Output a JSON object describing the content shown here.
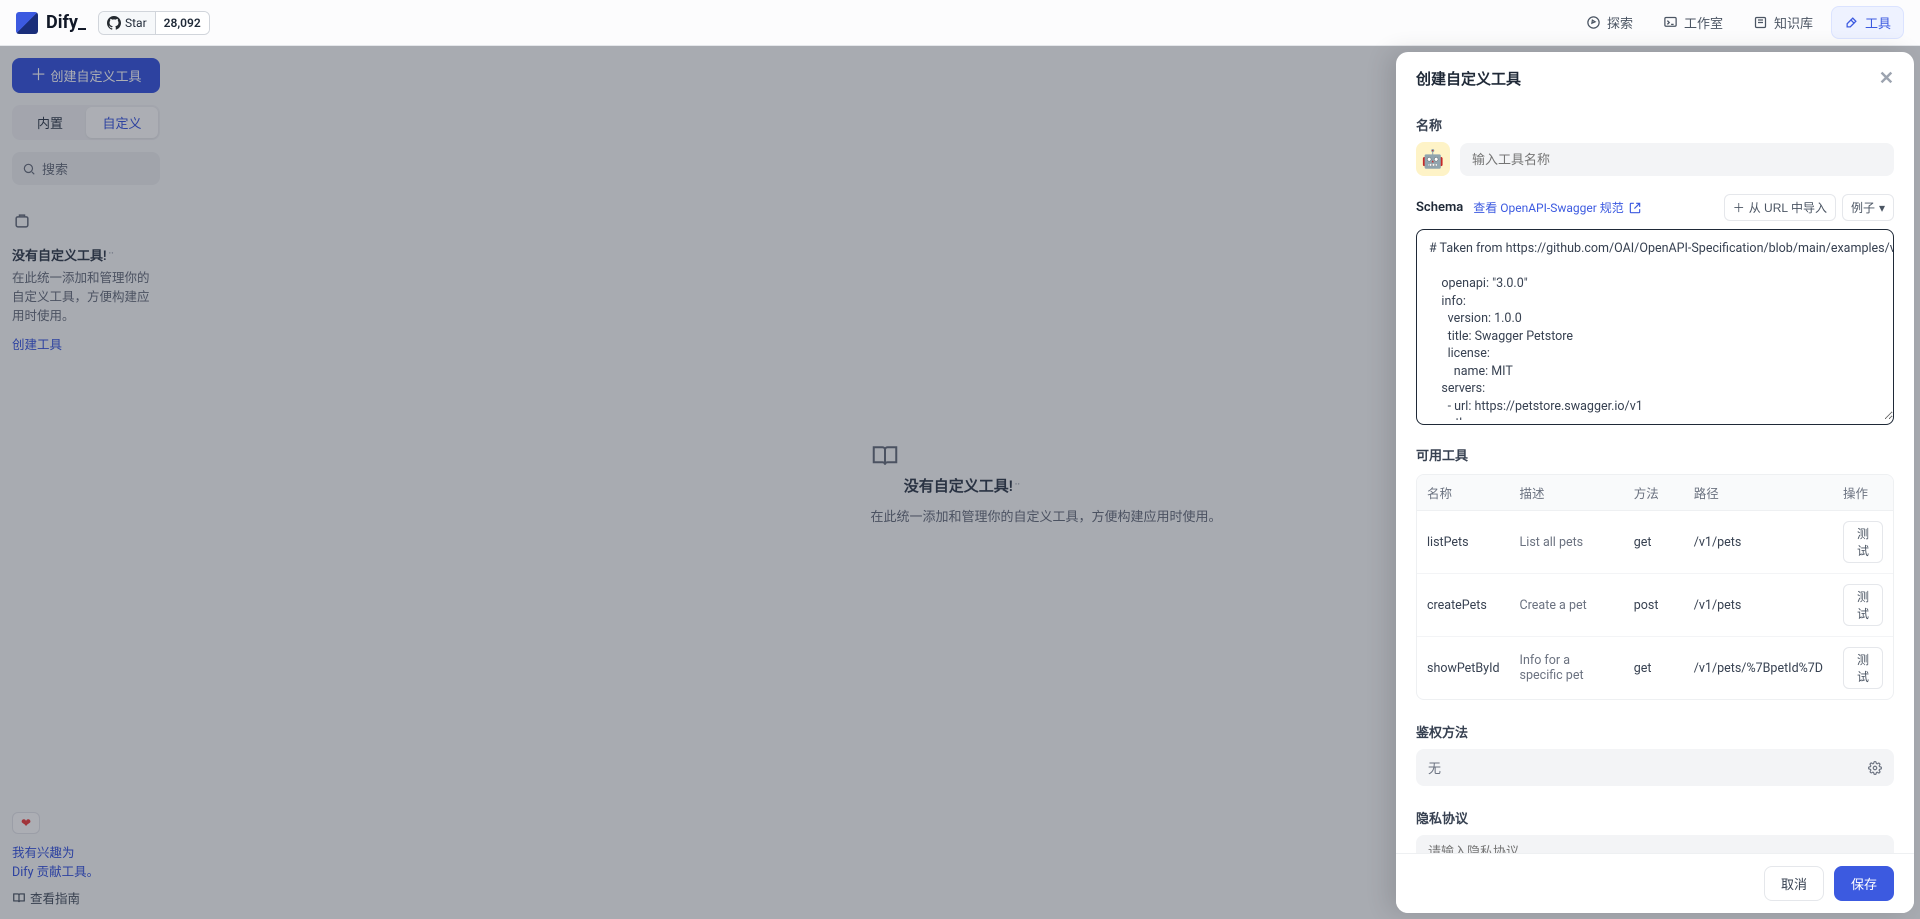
{
  "header": {
    "logo_text": "Dify_",
    "github": {
      "star_label": "Star",
      "stars": "28,092"
    },
    "nav": {
      "explore": "探索",
      "studio": "工作室",
      "knowledge": "知识库",
      "tools": "工具"
    }
  },
  "sidebar": {
    "create_button": "创建自定义工具",
    "tabs": {
      "builtin": "内置",
      "custom": "自定义"
    },
    "search_placeholder": "搜索",
    "empty": {
      "title": "没有自定义工具!",
      "desc": "在此统一添加和管理你的自定义工具，方便构建应用时使用。",
      "create_link": "创建工具"
    },
    "footer": {
      "line1": "我有兴趣为",
      "line2": "Dify 贡献工具。",
      "guide": "查看指南"
    }
  },
  "center": {
    "title": "没有自定义工具!",
    "desc": "在此统一添加和管理你的自定义工具，方便构建应用时使用。"
  },
  "drawer": {
    "title": "创建自定义工具",
    "name_label": "名称",
    "name_placeholder": "输入工具名称",
    "tool_emoji": "🤖",
    "schema_label": "Schema",
    "spec_link": "查看 OpenAPI-Swagger 规范",
    "import_url": "从 URL 中导入",
    "examples": "例子",
    "schema_text": "# Taken from https://github.com/OAI/OpenAPI-Specification/blob/main/examples/v3.0/petstore.yaml\n\n    openapi: \"3.0.0\"\n    info:\n      version: 1.0.0\n      title: Swagger Petstore\n      license:\n        name: MIT\n    servers:\n      - url: https://petstore.swagger.io/v1\n    paths:\n      /pets:\n        get:\n          summary: List all pets",
    "available_label": "可用工具",
    "columns": {
      "name": "名称",
      "desc": "描述",
      "method": "方法",
      "path": "路径",
      "op": "操作"
    },
    "rows": [
      {
        "name": "listPets",
        "desc": "List all pets",
        "method": "get",
        "path": "/v1/pets"
      },
      {
        "name": "createPets",
        "desc": "Create a pet",
        "method": "post",
        "path": "/v1/pets"
      },
      {
        "name": "showPetById",
        "desc": "Info for a specific pet",
        "method": "get",
        "path": "/v1/pets/%7BpetId%7D"
      }
    ],
    "test_label": "测试",
    "auth_label": "鉴权方法",
    "auth_value": "无",
    "privacy_label": "隐私协议",
    "privacy_placeholder": "请输入隐私协议",
    "cancel": "取消",
    "save": "保存"
  }
}
